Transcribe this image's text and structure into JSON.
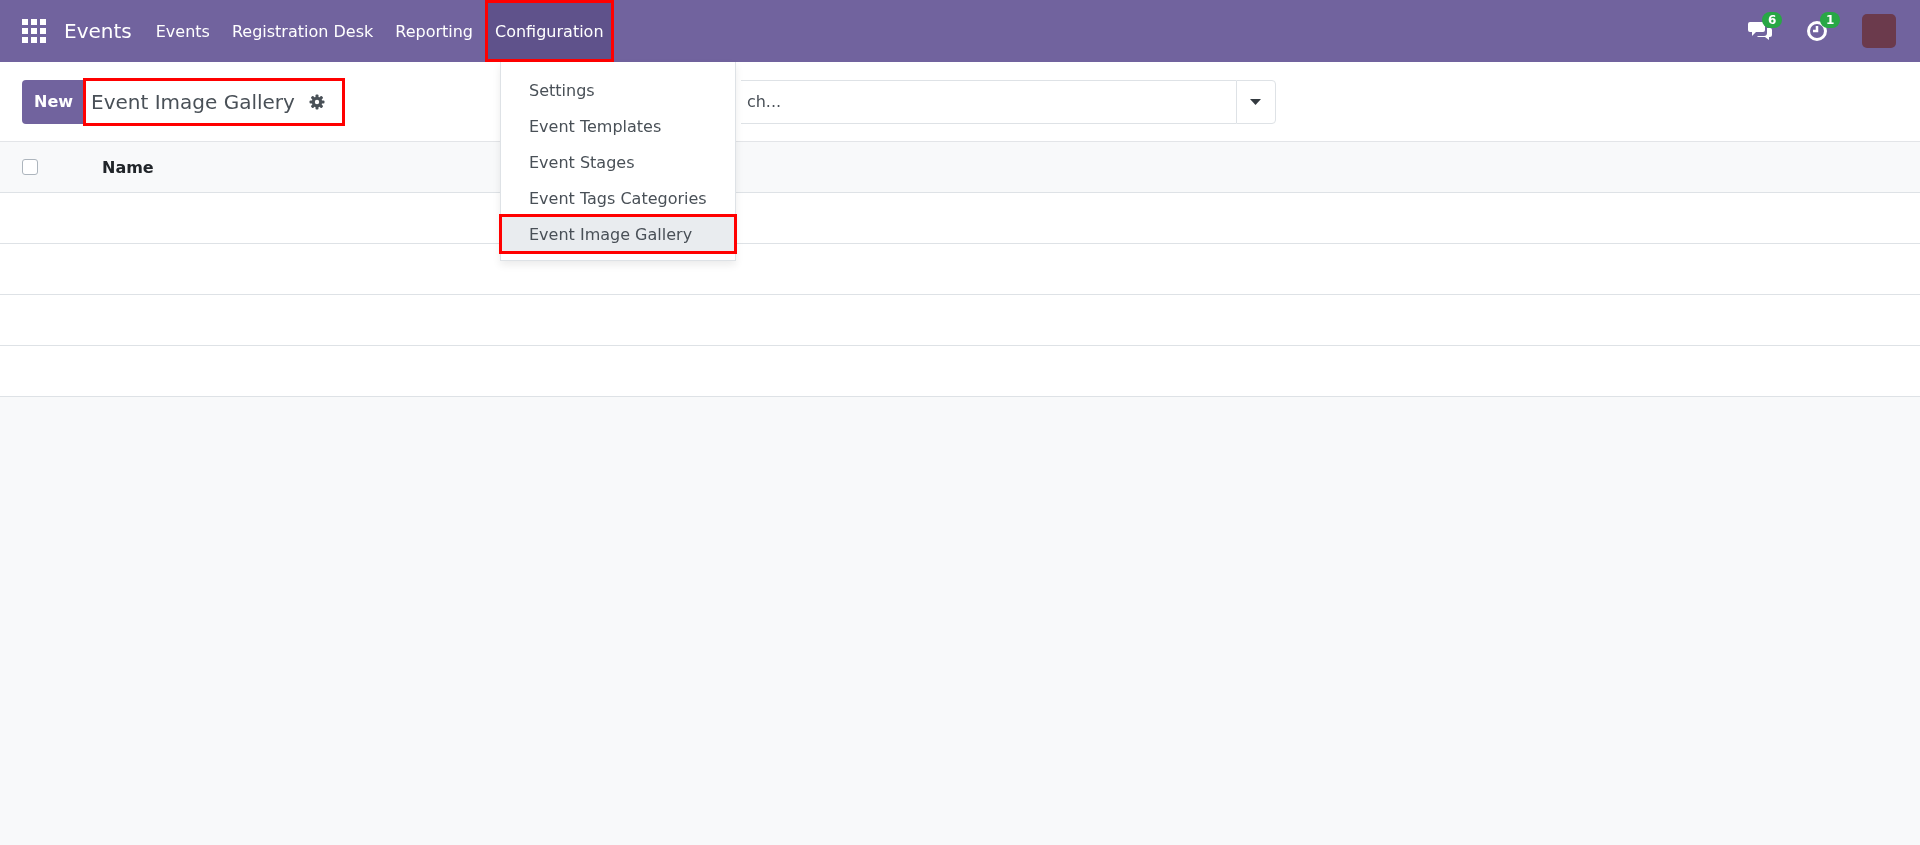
{
  "navbar": {
    "app_name": "Events",
    "menus": [
      {
        "label": "Events",
        "selected": false,
        "highlighted": false
      },
      {
        "label": "Registration Desk",
        "selected": false,
        "highlighted": false
      },
      {
        "label": "Reporting",
        "selected": false,
        "highlighted": false
      },
      {
        "label": "Configuration",
        "selected": true,
        "highlighted": true
      }
    ],
    "messages_badge": "6",
    "activities_badge": "1"
  },
  "dropdown": {
    "items": [
      {
        "label": "Settings",
        "selected": false,
        "highlighted": false
      },
      {
        "label": "Event Templates",
        "selected": false,
        "highlighted": false
      },
      {
        "label": "Event Stages",
        "selected": false,
        "highlighted": false
      },
      {
        "label": "Event Tags Categories",
        "selected": false,
        "highlighted": false
      },
      {
        "label": "Event Image Gallery",
        "selected": true,
        "highlighted": true
      }
    ]
  },
  "control_panel": {
    "new_button": "New",
    "title": "Event Image Gallery",
    "title_highlighted": true,
    "search": {
      "placeholder": "ch..."
    }
  },
  "table": {
    "select_all_checked": false,
    "columns": [
      "Name"
    ]
  }
}
